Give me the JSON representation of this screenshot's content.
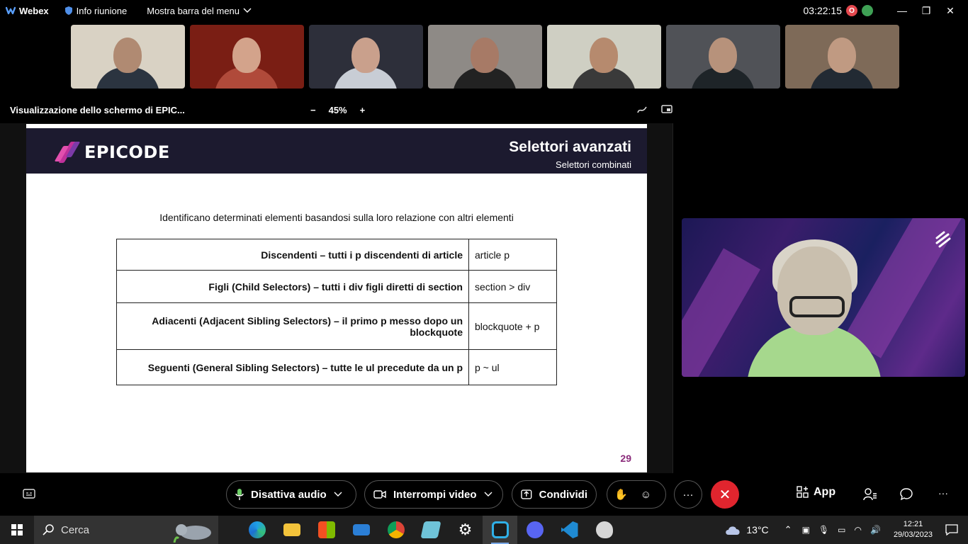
{
  "topbar": {
    "app_name": "Webex",
    "meeting_info": "Info riunione",
    "menu_bar": "Mostra barra del menu",
    "timer": "03:22:15",
    "rec_badge": "O"
  },
  "participants": [
    {
      "bg": "#d9d2c4",
      "skin": "#b08a72",
      "shirt": "#2b3440"
    },
    {
      "bg": "#7a1e14",
      "skin": "#d3a38b",
      "shirt": "#b04a3a"
    },
    {
      "bg": "#2d2f3a",
      "skin": "#c9a08c",
      "shirt": "#c8cdd5"
    },
    {
      "bg": "#8e8a86",
      "skin": "#a77a66",
      "shirt": "#222222"
    },
    {
      "bg": "#cfcfc3",
      "skin": "#b68a6e",
      "shirt": "#3a3a3a"
    },
    {
      "bg": "#505257",
      "skin": "#b7927b",
      "shirt": "#1e2428"
    },
    {
      "bg": "#7e6a58",
      "skin": "#c09a82",
      "shirt": "#222a33"
    }
  ],
  "sharebar": {
    "title": "Visualizzazione dello schermo di EPIC...",
    "zoom": "45%",
    "zoom_minus": "−",
    "zoom_plus": "+"
  },
  "slide": {
    "brand": "EPICODE",
    "title": "Selettori avanzati",
    "subtitle": "Selettori combinati",
    "intro": "Identificano determinati elementi basandosi sulla loro relazione con altri elementi",
    "rows": [
      {
        "label": "Discendenti – tutti i p discendenti di article",
        "code": "article p"
      },
      {
        "label": "Figli (Child Selectors) – tutti i div figli diretti di section",
        "code": "section > div"
      },
      {
        "label": "Adiacenti (Adjacent Sibling Selectors) – il primo p messo dopo un blockquote",
        "code": "blockquote + p"
      },
      {
        "label": "Seguenti (General Sibling Selectors) – tutte le ul precedute da un p",
        "code": "p ~ ul"
      }
    ],
    "page": "29"
  },
  "controls": {
    "audio": "Disattiva audio",
    "video": "Interrompi video",
    "share": "Condividi",
    "more": "···",
    "apps": "App"
  },
  "taskbar": {
    "search": "Cerca",
    "temperature": "13°C",
    "time": "12:21",
    "date": "29/03/2023"
  },
  "colors": {
    "accent_magenta": "#c0309a",
    "slide_header": "#1c1a2f",
    "end_call": "#e0252e"
  }
}
